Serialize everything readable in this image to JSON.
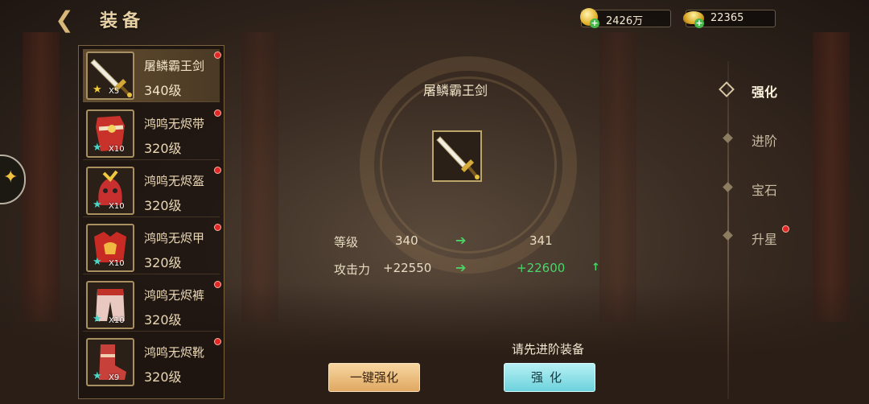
{
  "header": {
    "title": "装备"
  },
  "currencies": [
    {
      "icon": "gold-coin-icon",
      "amount": "2426万"
    },
    {
      "icon": "gold-ingot-icon",
      "amount": "22365"
    }
  ],
  "equipment": [
    {
      "name": "屠鳞霸王剑",
      "level": "340级",
      "qty": "X5",
      "star": "gold",
      "selected": true
    },
    {
      "name": "鸿鸣无烬带",
      "level": "320级",
      "qty": "X10",
      "star": "teal"
    },
    {
      "name": "鸿鸣无烬盔",
      "level": "320级",
      "qty": "X10",
      "star": "teal"
    },
    {
      "name": "鸿鸣无烬甲",
      "level": "320级",
      "qty": "X10",
      "star": "teal"
    },
    {
      "name": "鸿鸣无烬裤",
      "level": "320级",
      "qty": "X10",
      "star": "teal"
    },
    {
      "name": "鸿鸣无烬靴",
      "level": "320级",
      "qty": "X9",
      "star": "teal"
    }
  ],
  "detail": {
    "weapon_name": "屠鳞霸王剑",
    "stats": [
      {
        "label": "等级",
        "current": "340",
        "next": "341"
      },
      {
        "label": "攻击力",
        "current": "+22550",
        "next": "+22600",
        "up": "↑"
      }
    ],
    "arrow": "➔",
    "hint": "请先进阶装备",
    "btn_auto": "一键强化",
    "btn_enhance": "强化"
  },
  "tabs": [
    {
      "label": "强化",
      "active": true
    },
    {
      "label": "进阶"
    },
    {
      "label": "宝石"
    },
    {
      "label": "升星",
      "badge": true
    }
  ],
  "colors": {
    "accent_gold": "#e8d2a4",
    "stat_green": "#4bd46a",
    "badge_red": "#e02828"
  }
}
